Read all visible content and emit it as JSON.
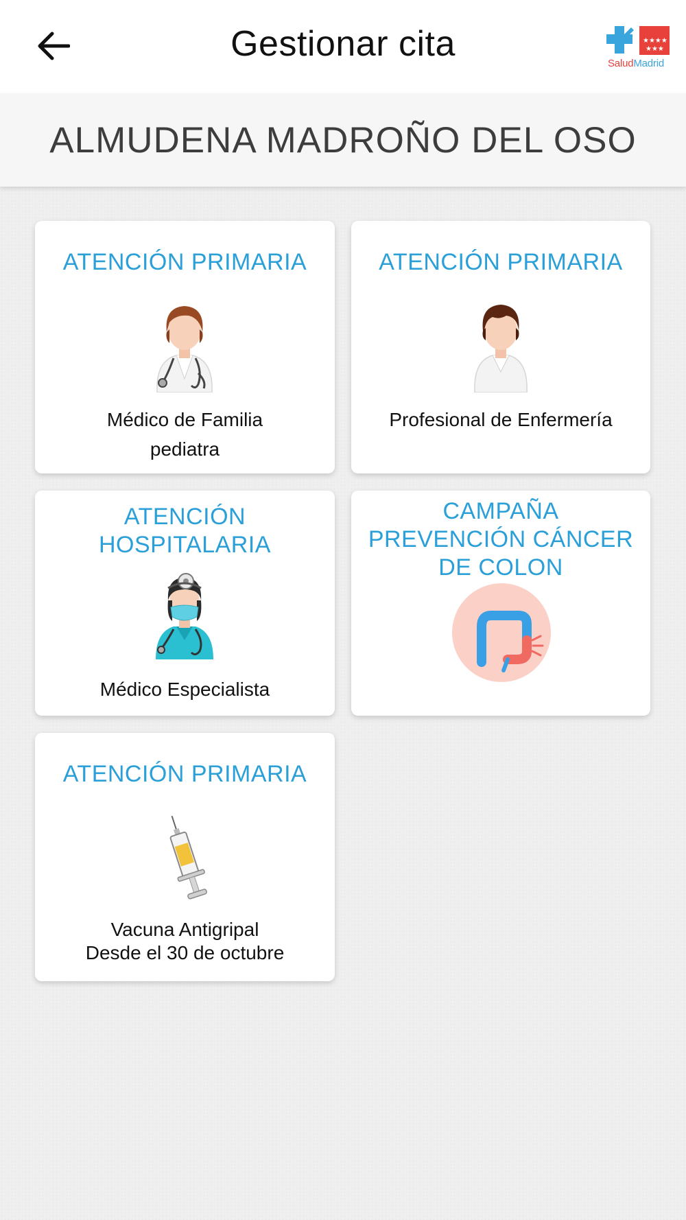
{
  "header": {
    "title": "Gestionar cita",
    "back_icon": "arrow-left-icon",
    "logo": {
      "part1": "Salud",
      "part2": "Madrid",
      "brand_red": "#e8403b",
      "brand_blue": "#3aa4dc"
    }
  },
  "patient": {
    "name": "ALMUDENA MADROÑO DEL OSO"
  },
  "colors": {
    "accent": "#2a9fd8",
    "background": "#efefef",
    "card": "#ffffff"
  },
  "cards": [
    {
      "title": "ATENCIÓN PRIMARIA",
      "icon": "family-doctor-icon",
      "line1": "Médico de Familia",
      "line2": "pediatra"
    },
    {
      "title": "ATENCIÓN PRIMARIA",
      "icon": "nurse-icon",
      "line1": "Profesional de Enfermería"
    },
    {
      "title_line1": "ATENCIÓN",
      "title_line2": "HOSPITALARIA",
      "icon": "specialist-doctor-icon",
      "line1": "Médico Especialista"
    },
    {
      "title_line1": "CAMPAÑA",
      "title_line2": "PREVENCIÓN CÁNCER",
      "title_line3": "DE COLON",
      "icon": "colon-icon"
    },
    {
      "title": "ATENCIÓN PRIMARIA",
      "icon": "syringe-icon",
      "line1": "Vacuna Antigripal",
      "line2": "Desde el 30 de octubre"
    }
  ]
}
